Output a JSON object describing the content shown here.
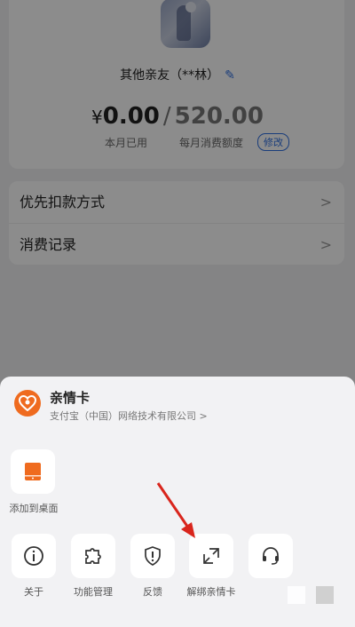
{
  "colors": {
    "accent_blue": "#2f6fe0",
    "logo_orange": "#ef6b1f",
    "arrow_red": "#d9251c"
  },
  "profile": {
    "name": "其他亲友（**林）",
    "edit_icon": "pencil-icon"
  },
  "amount": {
    "currency": "¥",
    "used": "0.00",
    "slash": "/",
    "quota": "520.00",
    "used_label": "本月已用",
    "quota_label": "每月消费额度",
    "edit_label": "修改"
  },
  "list": [
    {
      "label": "优先扣款方式",
      "chevron": "chevron-right-icon"
    },
    {
      "label": "消费记录",
      "chevron": "chevron-right-icon"
    }
  ],
  "sheet": {
    "app_name": "亲情卡",
    "company": "支付宝（中国）网络技术有限公司 >",
    "shortcut": {
      "label": "添加到桌面",
      "icon": "phone-add-icon"
    },
    "actions": [
      {
        "label": "关于",
        "icon": "info-icon"
      },
      {
        "label": "功能管理",
        "icon": "puzzle-icon"
      },
      {
        "label": "反馈",
        "icon": "shield-alert-icon"
      },
      {
        "label": "解绑亲情卡",
        "icon": "unlink-icon"
      },
      {
        "label": "",
        "icon": "headset-icon"
      }
    ]
  }
}
